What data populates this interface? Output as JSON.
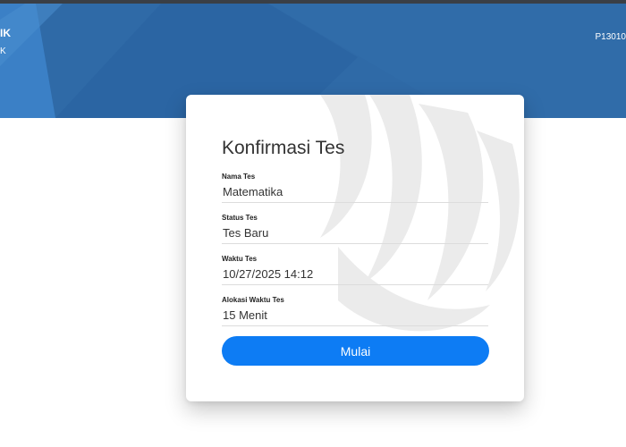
{
  "header": {
    "brand_line1": "IK",
    "brand_line2": "K",
    "user_code": "P13010",
    "bg_color": "#2f6aa7"
  },
  "card": {
    "title": "Konfirmasi Tes",
    "fields": [
      {
        "label": "Nama Tes",
        "value": "Matematika"
      },
      {
        "label": "Status Tes",
        "value": "Tes Baru"
      },
      {
        "label": "Waktu Tes",
        "value": "10/27/2025 14:12"
      },
      {
        "label": "Alokasi Waktu Tes",
        "value": "15 Menit"
      }
    ],
    "start_button": {
      "label": "Mulai",
      "color": "#0d7cf4"
    }
  }
}
